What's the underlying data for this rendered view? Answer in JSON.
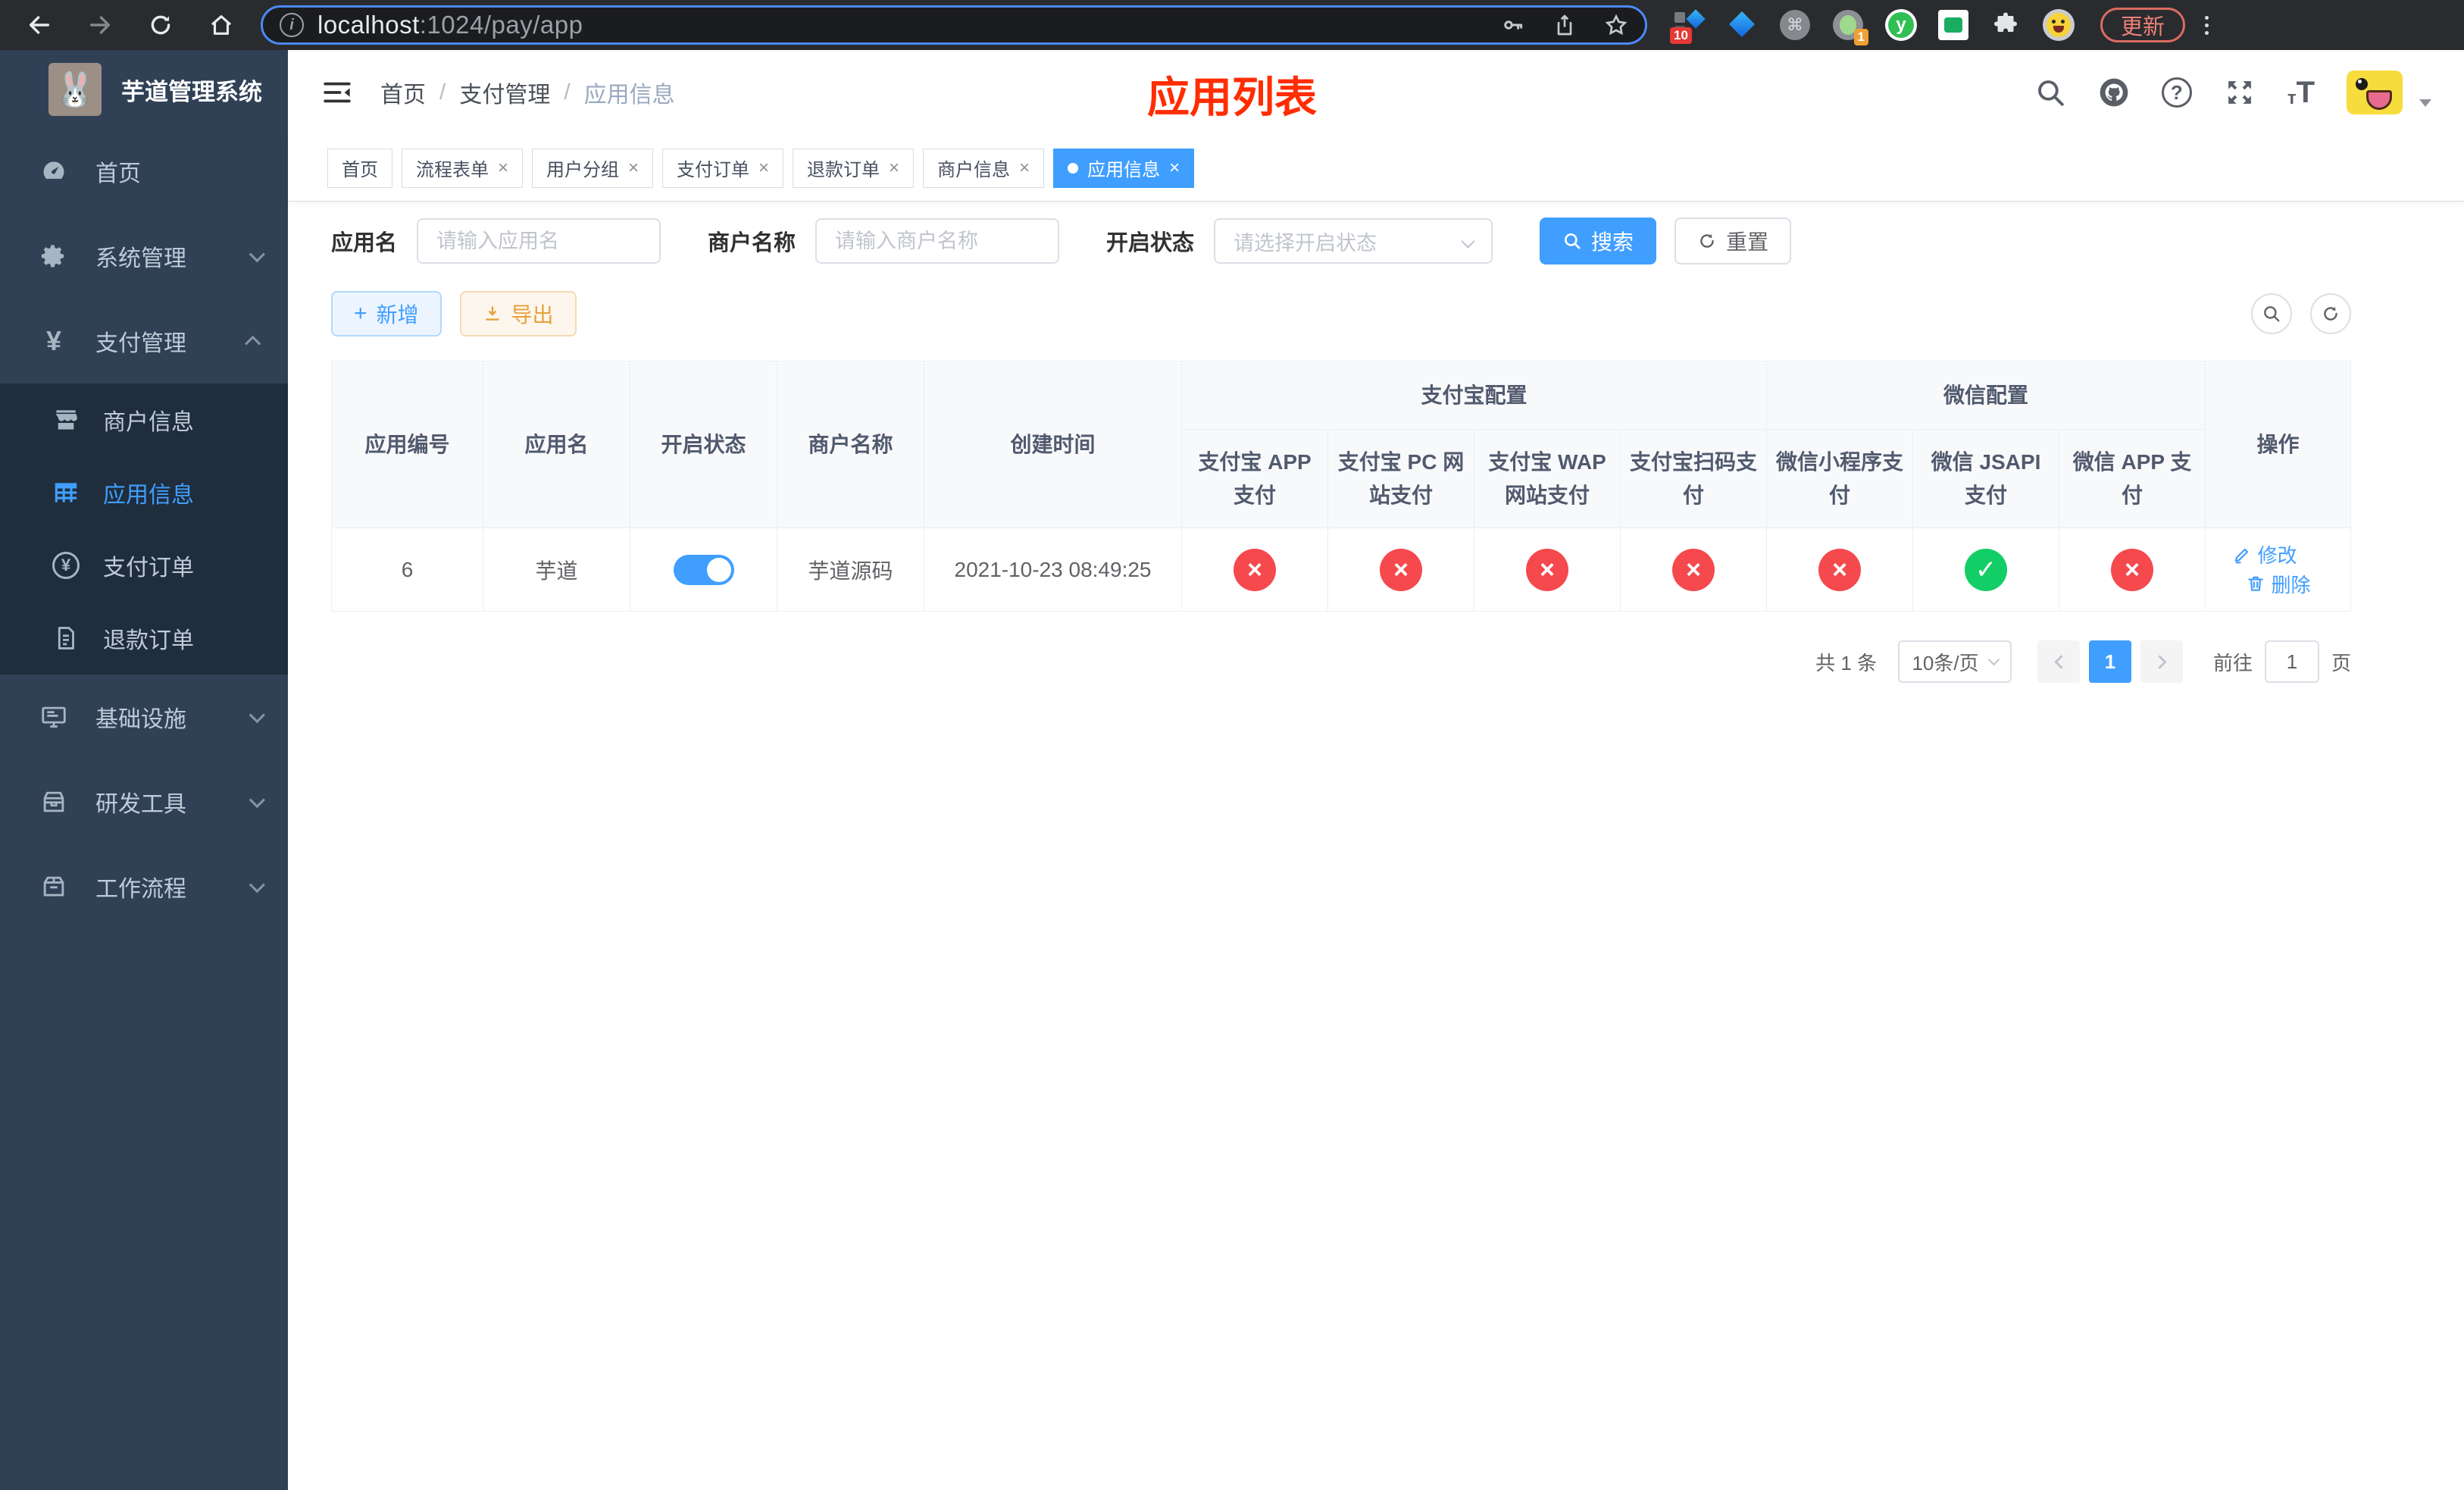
{
  "browser": {
    "url": {
      "host": "localhost",
      "path": ":1024/pay/app"
    },
    "extensions": {
      "badge_a": "10",
      "badge_b": "1",
      "y_letter": "y",
      "cmd_glyph": "⌘"
    },
    "update_label": "更新"
  },
  "sidebar": {
    "logo_emoji": "🐰",
    "title": "芋道管理系统",
    "items": {
      "home": "首页",
      "system": "系统管理",
      "payment": "支付管理",
      "merchant": "商户信息",
      "app": "应用信息",
      "order": "支付订单",
      "refund": "退款订单",
      "infra": "基础设施",
      "dev": "研发工具",
      "workflow": "工作流程"
    }
  },
  "navbar": {
    "breadcrumb": {
      "home": "首页",
      "section": "支付管理",
      "current": "应用信息"
    },
    "annotation": "应用列表"
  },
  "tabs": [
    {
      "label": "首页",
      "closable": false,
      "active": false
    },
    {
      "label": "流程表单",
      "closable": true,
      "active": false
    },
    {
      "label": "用户分组",
      "closable": true,
      "active": false
    },
    {
      "label": "支付订单",
      "closable": true,
      "active": false
    },
    {
      "label": "退款订单",
      "closable": true,
      "active": false
    },
    {
      "label": "商户信息",
      "closable": true,
      "active": false
    },
    {
      "label": "应用信息",
      "closable": true,
      "active": true
    }
  ],
  "filters": {
    "app_name_label": "应用名",
    "app_name_placeholder": "请输入应用名",
    "merchant_label": "商户名称",
    "merchant_placeholder": "请输入商户名称",
    "status_label": "开启状态",
    "status_placeholder": "请选择开启状态",
    "search_label": "搜索",
    "reset_label": "重置"
  },
  "toolbar": {
    "add_label": "新增",
    "export_label": "导出"
  },
  "table": {
    "col_id": "应用编号",
    "col_name": "应用名",
    "col_status": "开启状态",
    "col_merchant": "商户名称",
    "col_created": "创建时间",
    "group_alipay": "支付宝配置",
    "group_wechat": "微信配置",
    "col_action": "操作",
    "sub_cols": [
      "支付宝 APP 支付",
      "支付宝 PC 网站支付",
      "支付宝 WAP 网站支付",
      "支付宝扫码支付",
      "微信小程序支付",
      "微信 JSAPI 支付",
      "微信 APP 支付"
    ],
    "row": {
      "id": "6",
      "name": "芋道",
      "enabled": true,
      "merchant": "芋道源码",
      "created": "2021-10-23 08:49:25",
      "configs": [
        "no",
        "no",
        "no",
        "no",
        "no",
        "yes",
        "no"
      ],
      "edit_label": "修改",
      "delete_label": "删除"
    }
  },
  "pagination": {
    "total": "共 1 条",
    "page_size": "10条/页",
    "page": "1",
    "goto_label": "前往",
    "goto_value": "1",
    "unit_label": "页"
  },
  "colors": {
    "accent": "#409eff",
    "success": "#13ce66",
    "danger": "#f5494d",
    "warning": "#e6a23c",
    "annotation_red": "#ff2d00",
    "sidebar_bg": "#304156",
    "submenu_bg": "#1f2d3d",
    "chrome_bg": "#2a2b2e"
  }
}
